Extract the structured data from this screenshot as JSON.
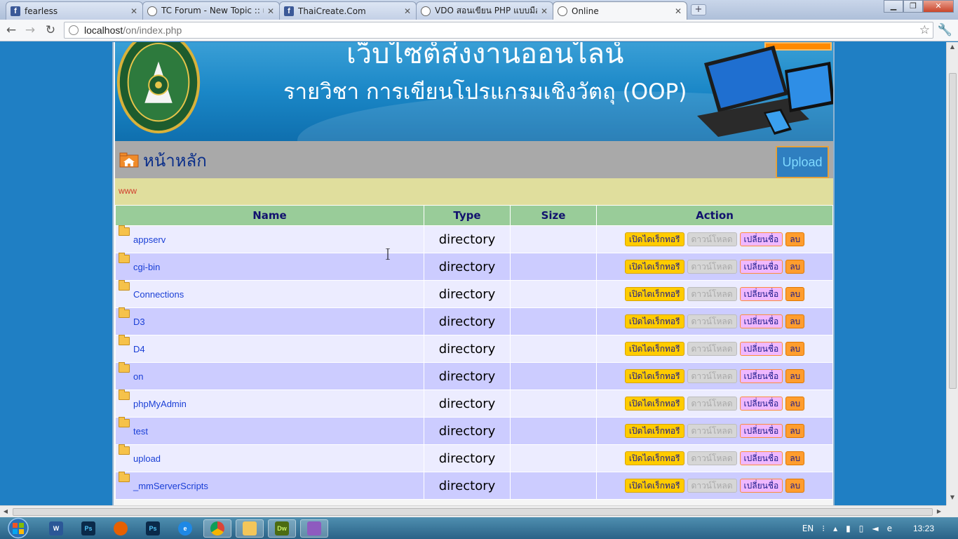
{
  "browser": {
    "tabs": [
      {
        "title": "fearless",
        "favicon": "facebook-icon",
        "active": false
      },
      {
        "title": "TC Forum - New Topic :: เริ่ม",
        "favicon": "globe-icon",
        "active": false
      },
      {
        "title": "ThaiCreate.Com",
        "favicon": "facebook-icon",
        "active": false
      },
      {
        "title": "VDO สอนเขียน PHP แบบมือใหม่",
        "favicon": "globe-icon",
        "active": false
      },
      {
        "title": "Online",
        "favicon": "globe-icon",
        "active": true
      }
    ],
    "url_host": "localhost",
    "url_path": "/on/index.php"
  },
  "banner": {
    "site_title": "เว็บไซต์ส่งงานออนไลน์",
    "subtitle": "รายวิชา การเขียนโปรแกรมเชิงวัตถุ (OOP)"
  },
  "path": {
    "label": "หน้าหลัก",
    "upload_label": "Upload"
  },
  "info": {
    "text": "www"
  },
  "table": {
    "headers": [
      "Name",
      "Type",
      "Size",
      "Action"
    ],
    "actions": {
      "open": "เปิดไดเร็กทอรี",
      "download": "ดาวน์โหลด",
      "rename": "เปลี่ยนชื่อ",
      "delete": "ลบ"
    },
    "rows": [
      {
        "name": "appserv",
        "type": "directory",
        "size": ""
      },
      {
        "name": "cgi-bin",
        "type": "directory",
        "size": ""
      },
      {
        "name": "Connections",
        "type": "directory",
        "size": ""
      },
      {
        "name": "D3",
        "type": "directory",
        "size": ""
      },
      {
        "name": "D4",
        "type": "directory",
        "size": ""
      },
      {
        "name": "on",
        "type": "directory",
        "size": ""
      },
      {
        "name": "phpMyAdmin",
        "type": "directory",
        "size": ""
      },
      {
        "name": "test",
        "type": "directory",
        "size": ""
      },
      {
        "name": "upload",
        "type": "directory",
        "size": ""
      },
      {
        "name": "_mmServerScripts",
        "type": "directory",
        "size": ""
      }
    ]
  },
  "taskbar": {
    "apps": [
      "word-icon",
      "photoshop-icon",
      "firefox-icon",
      "photoshop-icon",
      "ie-icon",
      "chrome-icon",
      "explorer-icon",
      "dreamweaver-icon",
      "paint-icon"
    ],
    "language": "EN",
    "clock": "13:23"
  },
  "colors": {
    "page_bg": "#1f7fc4",
    "header_green": "#99cc99",
    "row_odd": "#ececff",
    "row_even": "#ccccff",
    "path_gray": "#a9a9a9",
    "info_khaki": "#e0de9d"
  }
}
